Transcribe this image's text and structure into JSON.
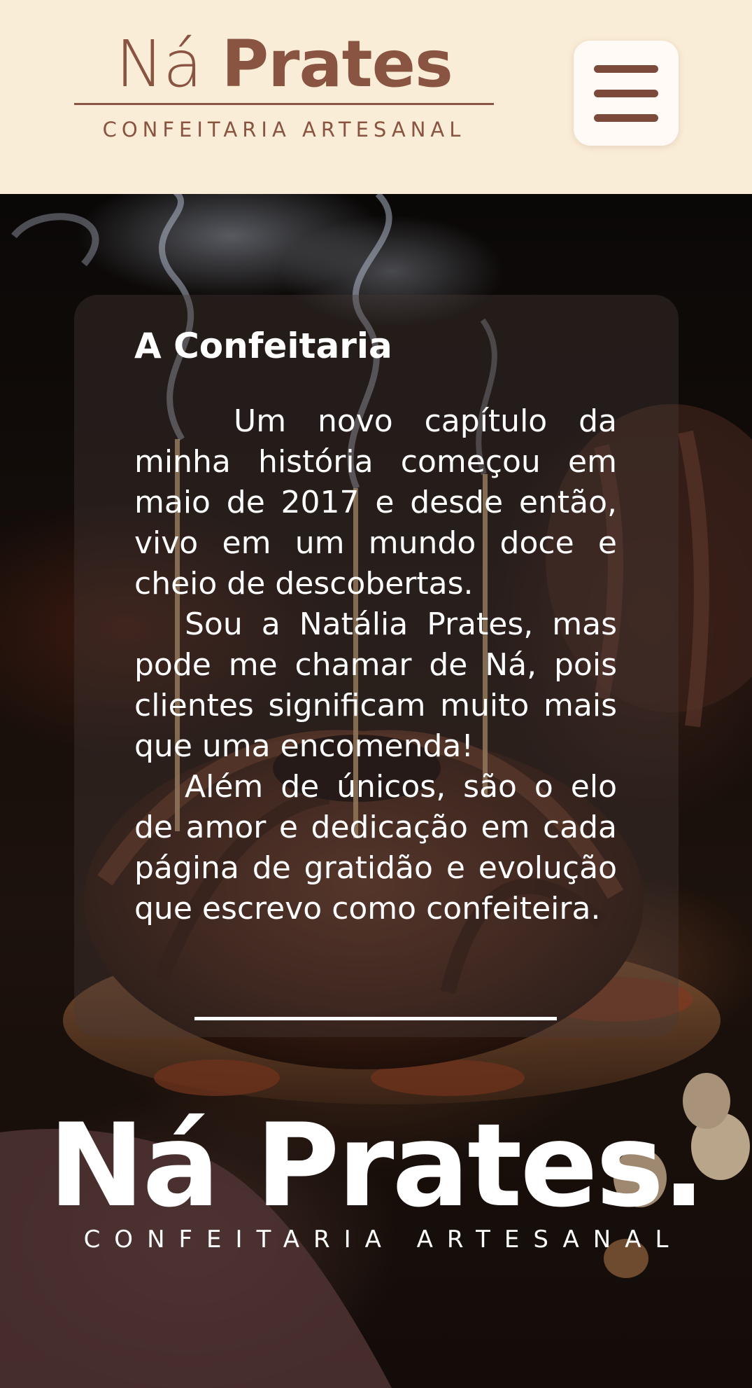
{
  "header": {
    "logo": {
      "name_light": "Ná",
      "name_bold": "Prates",
      "tagline": "CONFEITARIA ARTESANAL"
    },
    "menu_icon": "hamburger-menu-icon",
    "background_color": "#faedd7",
    "brand_color": "#8a5442"
  },
  "about": {
    "title": "A Confeitaria",
    "paragraphs": [
      "Um novo capítulo da minha história começou em maio de 2017 e desde então, vivo em um mundo doce e cheio de descobertas.",
      "Sou a Natália Prates, mas pode me chamar de Ná, pois clientes significam muito mais que uma encomenda!",
      "Além de únicos, são o elo de amor e dedicação em cada página de gratidão e evolução que escrevo como confeiteira."
    ]
  },
  "brand": {
    "name": "Ná Prates.",
    "tagline": "CONFEITARIA ARTESANAL"
  }
}
